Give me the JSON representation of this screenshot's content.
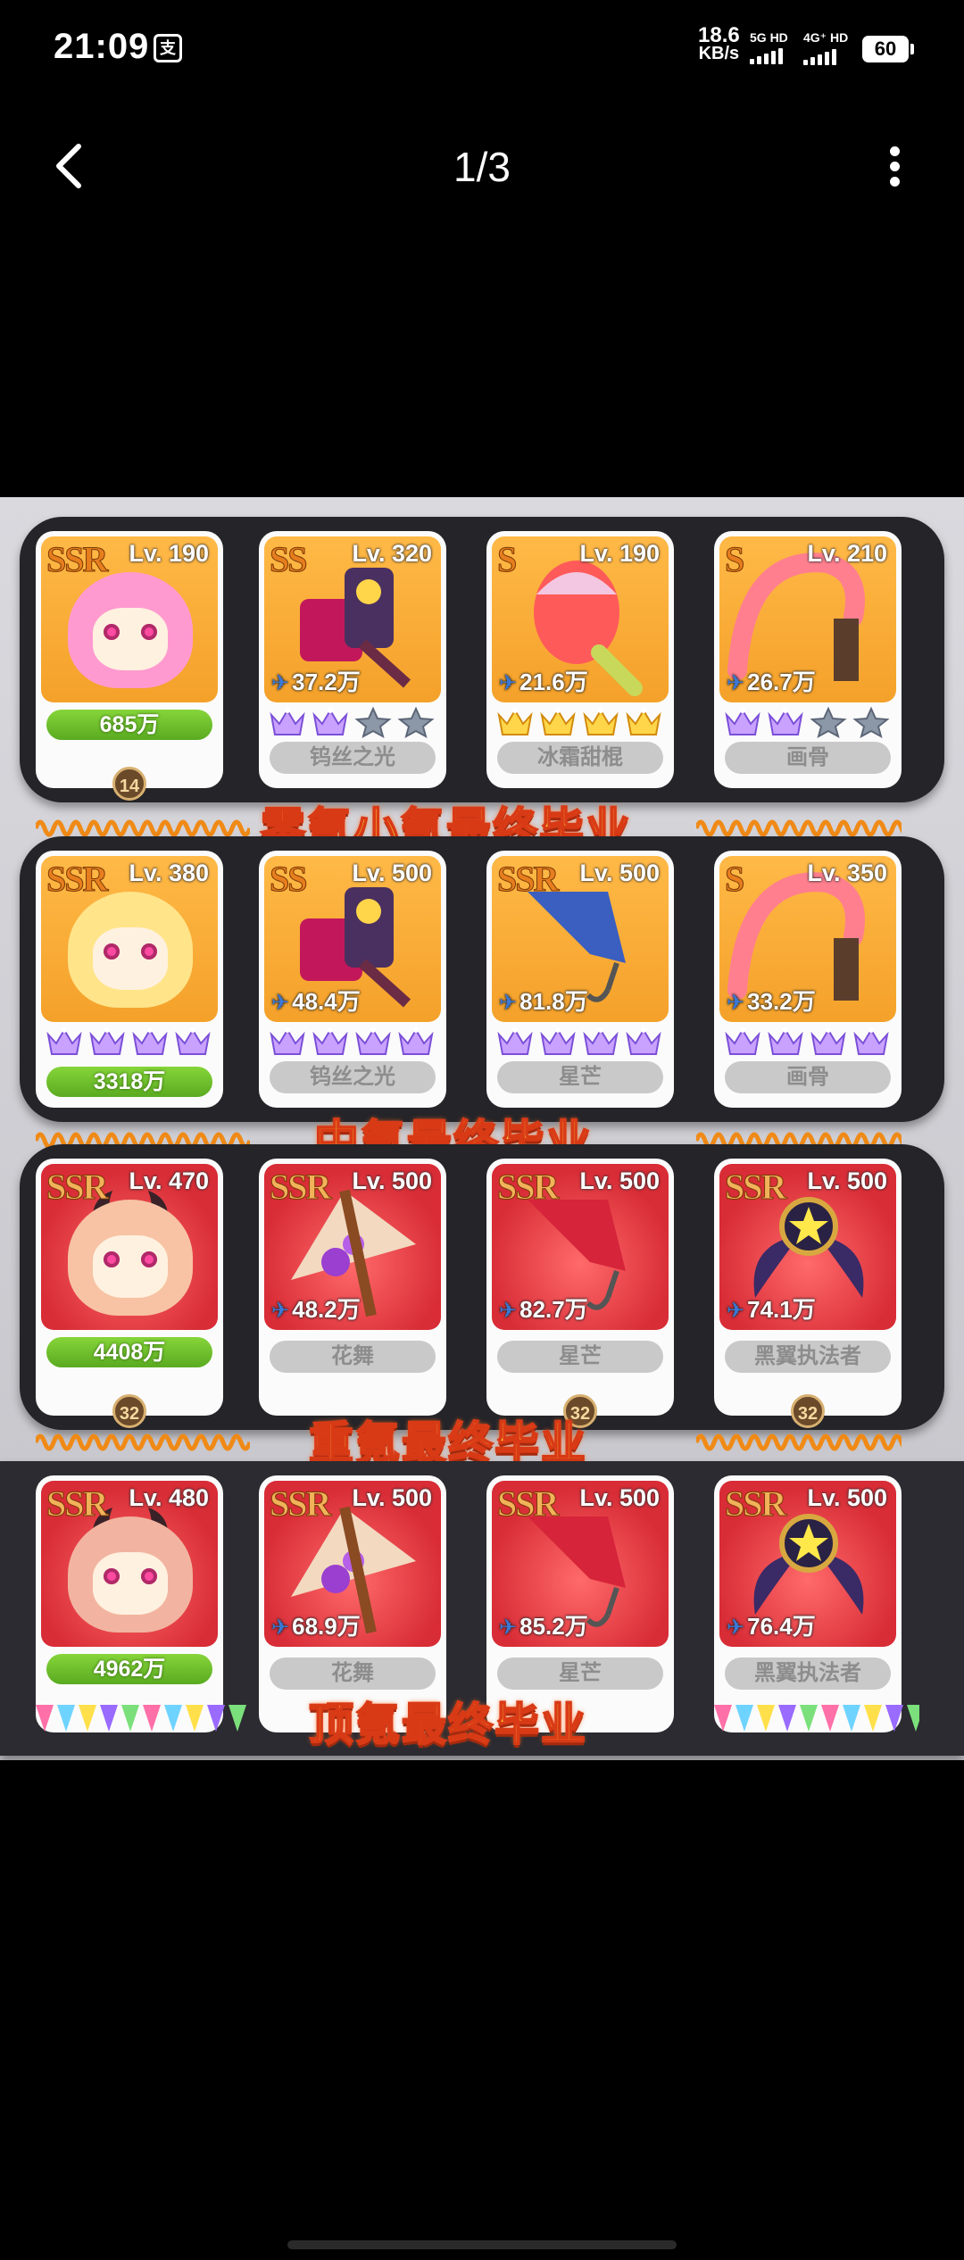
{
  "status_bar": {
    "time": "21:09",
    "pay_icon": "支",
    "speed_value": "18.6",
    "speed_unit": "KB/s",
    "net1": "5G HD",
    "net2": "4G⁺ HD",
    "battery": "60"
  },
  "navbar": {
    "page_indicator": "1/3",
    "back_icon": "chevron-left-icon",
    "more_icon": "more-vertical-icon"
  },
  "rows": [
    {
      "banner": "零氪小氪最终毕业",
      "character": {
        "rarity": "SSR",
        "level": "Lv. 190",
        "cp": "685万",
        "badge": "14"
      },
      "weapons": [
        {
          "rarity": "SS",
          "level": "Lv. 320",
          "power": "37.2万",
          "name": "钨丝之光",
          "crowns": [
            "purple",
            "purple",
            "gray",
            "gray"
          ]
        },
        {
          "rarity": "S",
          "level": "Lv. 190",
          "power": "21.6万",
          "name": "冰霜甜棍",
          "crowns": [
            "gold",
            "gold",
            "gold",
            "gold"
          ]
        },
        {
          "rarity": "S",
          "level": "Lv. 210",
          "power": "26.7万",
          "name": "画骨",
          "crowns": [
            "purple",
            "purple",
            "gray",
            "gray"
          ]
        }
      ]
    },
    {
      "banner": "中氪最终毕业",
      "character": {
        "rarity": "SSR",
        "level": "Lv. 380",
        "cp": "3318万"
      },
      "weapons": [
        {
          "rarity": "SS",
          "level": "Lv. 500",
          "power": "48.4万",
          "name": "钨丝之光",
          "crowns": [
            "purple",
            "purple",
            "purple",
            "purple"
          ]
        },
        {
          "rarity": "SSR",
          "level": "Lv. 500",
          "power": "81.8万",
          "name": "星芒",
          "crowns": [
            "purple",
            "purple",
            "purple",
            "purple"
          ]
        },
        {
          "rarity": "S",
          "level": "Lv. 350",
          "power": "33.2万",
          "name": "画骨",
          "crowns": [
            "purple",
            "purple",
            "purple",
            "purple"
          ]
        }
      ]
    },
    {
      "banner": "重氪最终毕业",
      "character": {
        "rarity": "SSR",
        "level": "Lv. 470",
        "cp": "4408万",
        "badge": "32"
      },
      "weapons": [
        {
          "rarity": "SSR",
          "level": "Lv. 500",
          "power": "48.2万",
          "name": "花舞"
        },
        {
          "rarity": "SSR",
          "level": "Lv. 500",
          "power": "82.7万",
          "name": "星芒",
          "badge": "32"
        },
        {
          "rarity": "SSR",
          "level": "Lv. 500",
          "power": "74.1万",
          "name": "黑翼执法者",
          "badge": "32"
        }
      ]
    },
    {
      "banner": "顶氪最终毕业",
      "character": {
        "rarity": "SSR",
        "level": "Lv. 480",
        "cp": "4962万"
      },
      "weapons": [
        {
          "rarity": "SSR",
          "level": "Lv. 500",
          "power": "68.9万",
          "name": "花舞"
        },
        {
          "rarity": "SSR",
          "level": "Lv. 500",
          "power": "85.2万",
          "name": "星芒"
        },
        {
          "rarity": "SSR",
          "level": "Lv. 500",
          "power": "76.4万",
          "name": "黑翼执法者"
        }
      ]
    }
  ]
}
